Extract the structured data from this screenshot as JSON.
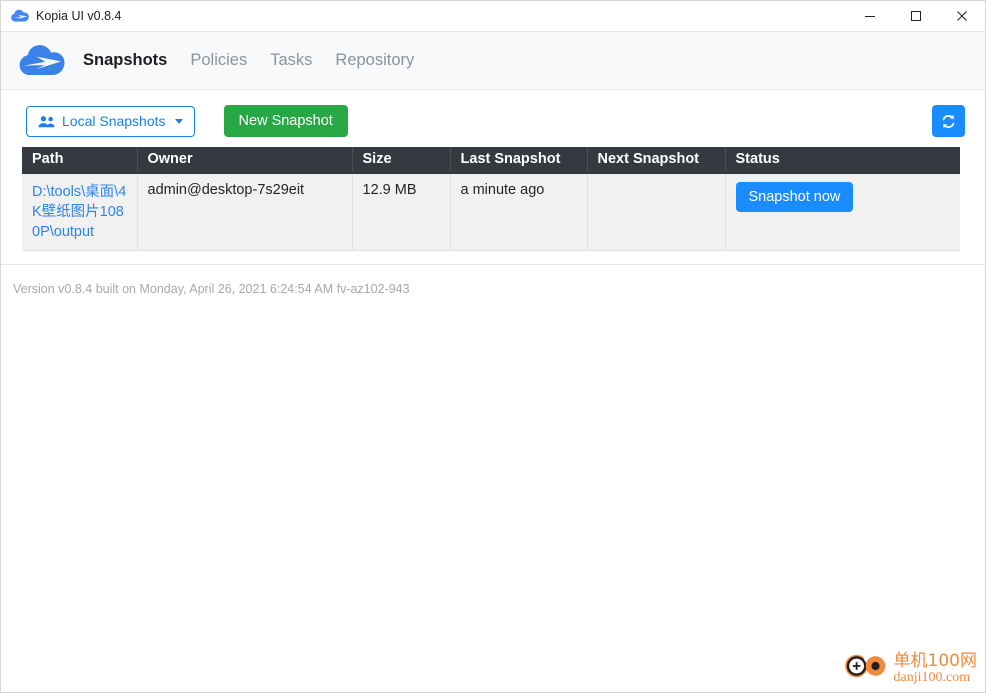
{
  "window": {
    "title": "Kopia UI v0.8.4",
    "app_icon": "kopia-cloud-icon",
    "controls": {
      "minimize": "minimize-icon",
      "maximize": "maximize-icon",
      "close": "close-icon"
    }
  },
  "navbar": {
    "brand_icon": "kopia-cloud-logo",
    "items": [
      {
        "label": "Snapshots",
        "active": true
      },
      {
        "label": "Policies",
        "active": false
      },
      {
        "label": "Tasks",
        "active": false
      },
      {
        "label": "Repository",
        "active": false
      }
    ]
  },
  "toolbar": {
    "dropdown_label": "Local Snapshots",
    "dropdown_icon": "people-icon",
    "new_snapshot_label": "New Snapshot",
    "refresh_icon": "refresh-icon"
  },
  "table": {
    "columns": [
      "Path",
      "Owner",
      "Size",
      "Last Snapshot",
      "Next Snapshot",
      "Status"
    ],
    "rows": [
      {
        "path": "D:\\tools\\桌面\\4K壁纸图片1080P\\output",
        "owner": "admin@desktop-7s29eit",
        "size": "12.9 MB",
        "last_snapshot": "a minute ago",
        "next_snapshot": "",
        "status_button": "Snapshot now"
      }
    ]
  },
  "footer": {
    "version_text": "Version v0.8.4 built on Monday, April 26, 2021 6:24:54 AM fv-az102-943"
  },
  "watermark": {
    "cn": "单机100网",
    "en": "danji100.com"
  },
  "colors": {
    "accent_blue": "#1a8cff",
    "link_blue": "#2a86f0",
    "success_green": "#28a745",
    "header_dark": "#343a40",
    "navbar_bg": "#f8f9fa",
    "watermark_orange": "#f08a3c"
  }
}
